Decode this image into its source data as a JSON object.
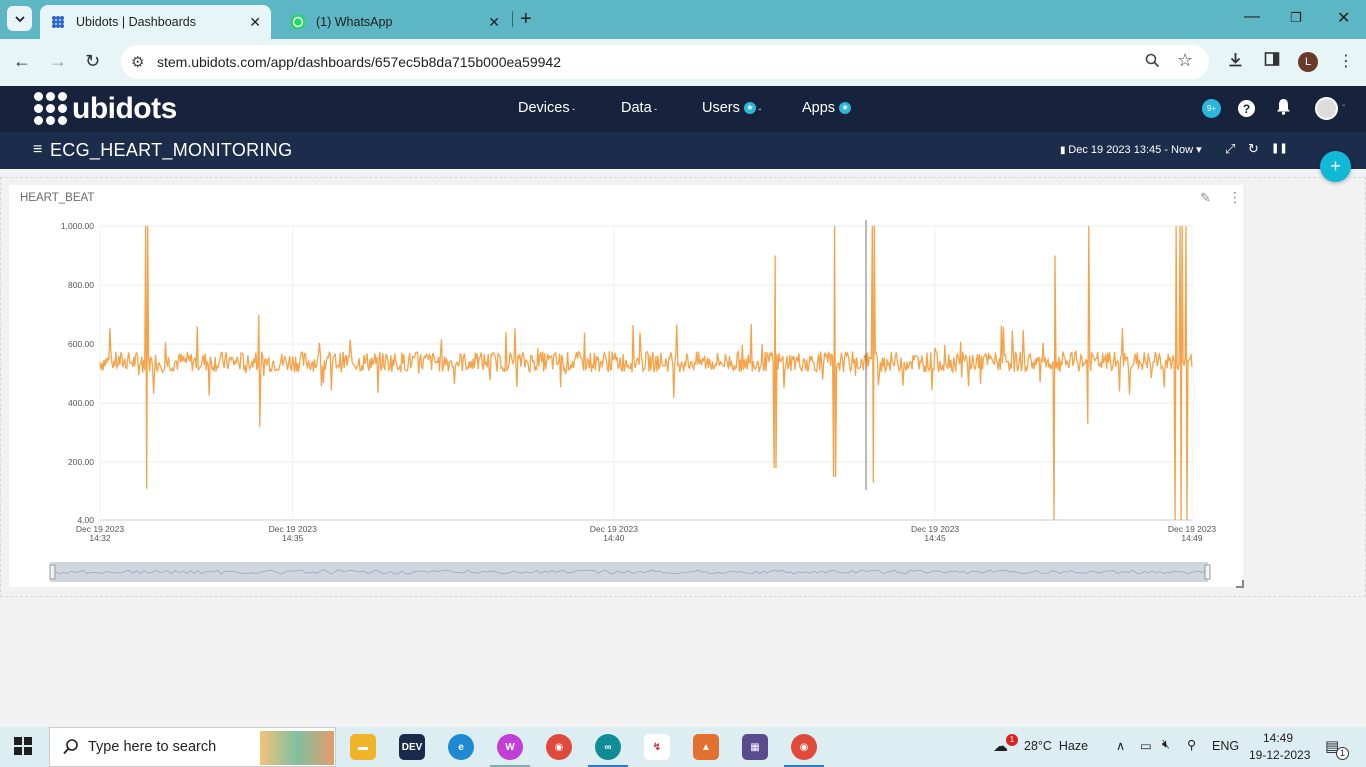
{
  "browser": {
    "tabs": [
      {
        "title": "Ubidots | Dashboards",
        "favicon": "ubidots-icon",
        "active": true
      },
      {
        "title": "(1) WhatsApp",
        "favicon": "whatsapp-icon",
        "active": false
      }
    ],
    "url": "stem.ubidots.com/app/dashboards/657ec5b8da715b000ea59942",
    "profile_initial": "L"
  },
  "ubidots": {
    "logo_text": "ubidots",
    "menu": [
      {
        "label": "Devices",
        "star": false
      },
      {
        "label": "Data",
        "star": false
      },
      {
        "label": "Users",
        "star": true
      },
      {
        "label": "Apps",
        "star": true
      }
    ],
    "notifications_badge": "9+",
    "help_label": "?"
  },
  "dashboard": {
    "title": "ECG_HEART_MONITORING",
    "date_range": "Dec 19 2023 13:45 - Now"
  },
  "widget": {
    "title": "HEART_BEAT"
  },
  "chart_data": {
    "type": "line",
    "title": "HEART_BEAT",
    "line_color": "#f5a34a",
    "ylim": [
      4,
      1000
    ],
    "y_ticks": [
      "1,000.00",
      "800.00",
      "600.00",
      "400.00",
      "200.00",
      "4.00"
    ],
    "x_ticks": [
      {
        "date": "Dec 19 2023",
        "time": "14:32"
      },
      {
        "date": "Dec 19 2023",
        "time": "14:35"
      },
      {
        "date": "Dec 19 2023",
        "time": "14:40"
      },
      {
        "date": "Dec 19 2023",
        "time": "14:45"
      },
      {
        "date": "Dec 19 2023",
        "time": "14:49"
      }
    ],
    "x_range": [
      "14:32",
      "14:49"
    ],
    "series": [
      {
        "x": [
          "14:32",
          "14:33",
          "14:34",
          "14:35",
          "14:36",
          "14:37",
          "14:38",
          "14:39",
          "14:40",
          "14:41",
          "14:42",
          "14:43",
          "14:44",
          "14:45",
          "14:46",
          "14:47",
          "14:48",
          "14:49"
        ],
        "values": [
          540,
          1000,
          520,
          560,
          550,
          545,
          550,
          540,
          540,
          545,
          550,
          1000,
          560,
          1000,
          555,
          560,
          1000,
          1000
        ]
      }
    ],
    "grid": true
  },
  "taskbar": {
    "search_placeholder": "Type here to search",
    "weather": "28°C  Haze",
    "weather_badge": "1",
    "lang": "ENG",
    "time": "14:49",
    "date": "19-12-2023",
    "notif_count": "1"
  }
}
